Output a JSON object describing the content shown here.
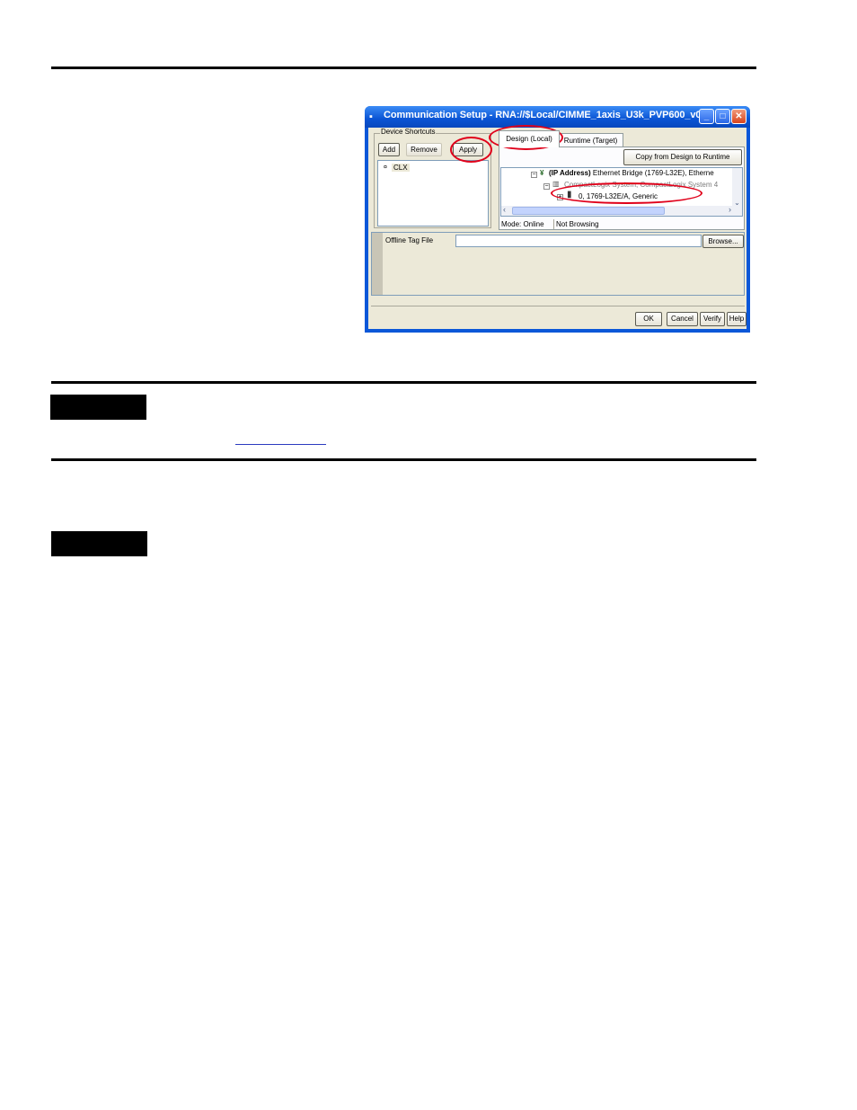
{
  "window": {
    "title": "Communication Setup - RNA://$Local/CIMME_1axis_U3k_PVP600_v0...",
    "minimize_glyph": "_",
    "maximize_glyph": "□",
    "close_glyph": "✕"
  },
  "shortcuts": {
    "group_label": "Device Shortcuts",
    "add_label": "Add",
    "remove_label": "Remove",
    "apply_label": "Apply",
    "items": [
      {
        "label": "CLX"
      }
    ]
  },
  "tabs": [
    {
      "label": "Design (Local)",
      "selected": true
    },
    {
      "label": "Runtime (Target)",
      "selected": false
    }
  ],
  "copy_button_label": "Copy from Design to Runtime",
  "tree": {
    "node1_bold": "(IP Address)",
    "node1_rest": "Ethernet Bridge (1769-L32E), Etherne",
    "node2": "CompactLogix System, CompactLogix System 4",
    "node3": "0, 1769-L32E/A, Generic"
  },
  "status": {
    "mode": "Mode: Online",
    "browsing": "Not Browsing"
  },
  "offline": {
    "label": "Offline Tag File",
    "value": "",
    "browse_label": "Browse..."
  },
  "footer_buttons": {
    "ok": "OK",
    "cancel": "Cancel",
    "verify": "Verify",
    "help": "Help"
  },
  "colors": {
    "highlight_oval": "#e0001a",
    "titlebar": "#0b57d8"
  }
}
